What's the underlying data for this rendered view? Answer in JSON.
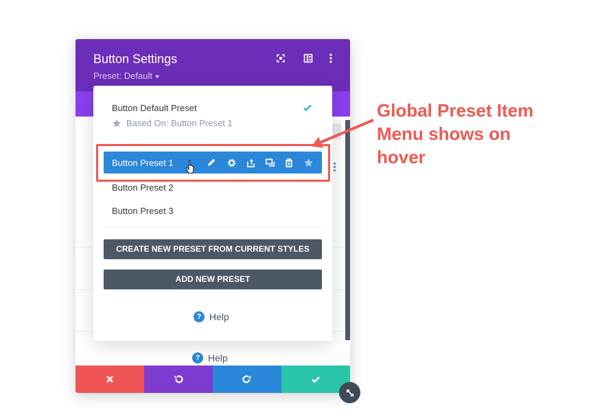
{
  "modal": {
    "title": "Button Settings",
    "preset_label": "Preset: Default",
    "header_icons": [
      "fullscreen-icon",
      "columns-icon",
      "more-vertical-icon"
    ],
    "help_label": "Help",
    "footer": [
      "cancel-icon",
      "undo-icon",
      "redo-icon",
      "save-check-icon"
    ]
  },
  "dropdown": {
    "default_preset": {
      "name": "Button Default Preset",
      "based_on": "Based On: Button Preset 1"
    },
    "presets": [
      {
        "label": "Button Preset 1",
        "hovered": true
      },
      {
        "label": "Button Preset 2",
        "hovered": false
      },
      {
        "label": "Button Preset 3",
        "hovered": false
      }
    ],
    "item_menu_icons": [
      "edit-pencil-icon",
      "gear-icon",
      "export-icon",
      "duplicate-icon",
      "trash-icon",
      "star-icon"
    ],
    "create_button": "CREATE NEW PRESET FROM CURRENT STYLES",
    "add_button": "ADD NEW PRESET",
    "help_label": "Help"
  },
  "annotation": {
    "line1": "Global Preset Item",
    "line2": "Menu shows on",
    "line3": "hover"
  },
  "colors": {
    "header": "#6c2eb9",
    "tabbar": "#8a3ff0",
    "highlight": "#2b87da",
    "annotation": "#ee5a52",
    "check": "#29c4a9",
    "dark_button": "#4c5866"
  }
}
